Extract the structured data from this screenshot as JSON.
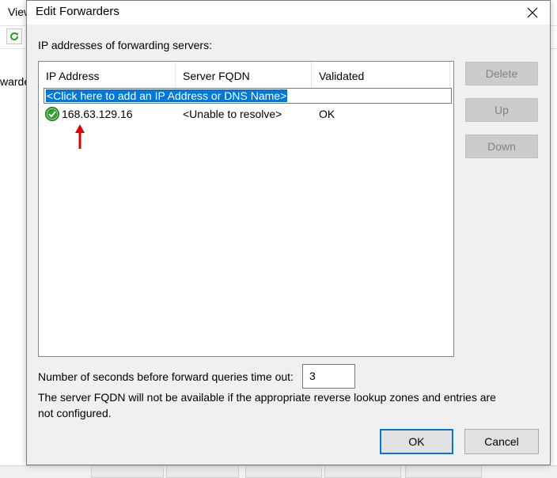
{
  "background_app": {
    "menu_fragment": "View",
    "left_text_fragment": "warde"
  },
  "dialog": {
    "title": "Edit Forwarders",
    "section_label": "IP addresses of forwarding servers:",
    "columns": [
      "IP Address",
      "Server FQDN",
      "Validated"
    ],
    "add_row_text": "<Click here to add an IP Address or DNS Name>",
    "rows": [
      {
        "ip": "168.63.129.16",
        "fqdn": "<Unable to resolve>",
        "validated": "OK",
        "status_icon": "check-icon"
      }
    ],
    "buttons": {
      "delete": "Delete",
      "up": "Up",
      "down": "Down",
      "ok": "OK",
      "cancel": "Cancel"
    },
    "timeout_label": "Number of seconds before forward queries time out:",
    "timeout_value": "3",
    "note": "The server FQDN will not be available if the appropriate reverse lookup zones and entries are not configured."
  },
  "colors": {
    "selection": "#0078d7",
    "annotation_arrow": "#e00000",
    "check_green": "#2e9e2e"
  }
}
